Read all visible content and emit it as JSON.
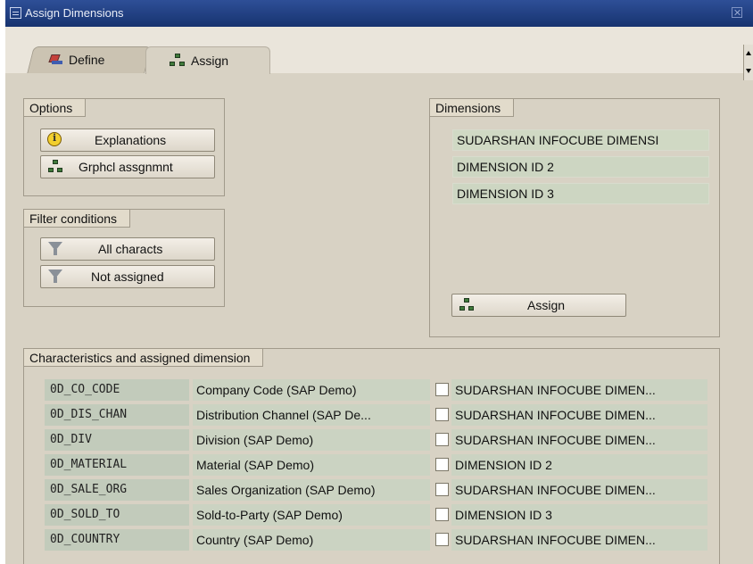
{
  "window": {
    "title": "Assign Dimensions"
  },
  "tabs": [
    {
      "label": "Define",
      "icon": "define-icon",
      "active": false
    },
    {
      "label": "Assign",
      "icon": "assign-icon",
      "active": true
    }
  ],
  "options": {
    "caption": "Options",
    "buttons": [
      {
        "label": "Explanations",
        "icon": "info-bulb-icon"
      },
      {
        "label": "Grphcl assgnmnt",
        "icon": "hierarchy-icon"
      }
    ]
  },
  "filter": {
    "caption": "Filter conditions",
    "buttons": [
      {
        "label": "All characts",
        "icon": "filter-icon"
      },
      {
        "label": "Not assigned",
        "icon": "filter-icon"
      }
    ]
  },
  "dimensions": {
    "caption": "Dimensions",
    "items": [
      "SUDARSHAN INFOCUBE DIMENSI",
      "DIMENSION ID 2",
      "DIMENSION ID 3"
    ],
    "assign_label": "Assign"
  },
  "characteristics": {
    "caption": "Characteristics and assigned dimension",
    "rows": [
      {
        "code": "0D_CO_CODE",
        "text": "Company Code (SAP Demo)",
        "dimension": "SUDARSHAN INFOCUBE DIMEN..."
      },
      {
        "code": "0D_DIS_CHAN",
        "text": "Distribution Channel (SAP De...",
        "dimension": "SUDARSHAN INFOCUBE DIMEN..."
      },
      {
        "code": "0D_DIV",
        "text": "Division (SAP Demo)",
        "dimension": "SUDARSHAN INFOCUBE DIMEN..."
      },
      {
        "code": "0D_MATERIAL",
        "text": "Material (SAP Demo)",
        "dimension": "DIMENSION ID 2"
      },
      {
        "code": "0D_SALE_ORG",
        "text": "Sales Organization (SAP Demo)",
        "dimension": "SUDARSHAN INFOCUBE DIMEN..."
      },
      {
        "code": "0D_SOLD_TO",
        "text": "Sold-to-Party (SAP Demo)",
        "dimension": "DIMENSION ID 3"
      },
      {
        "code": "0D_COUNTRY",
        "text": "Country (SAP Demo)",
        "dimension": "SUDARSHAN INFOCUBE DIMEN..."
      }
    ]
  },
  "colors": {
    "titlebar": "#1f3d82",
    "background": "#d8d2c4",
    "list_cell": "#cbd3c2"
  }
}
